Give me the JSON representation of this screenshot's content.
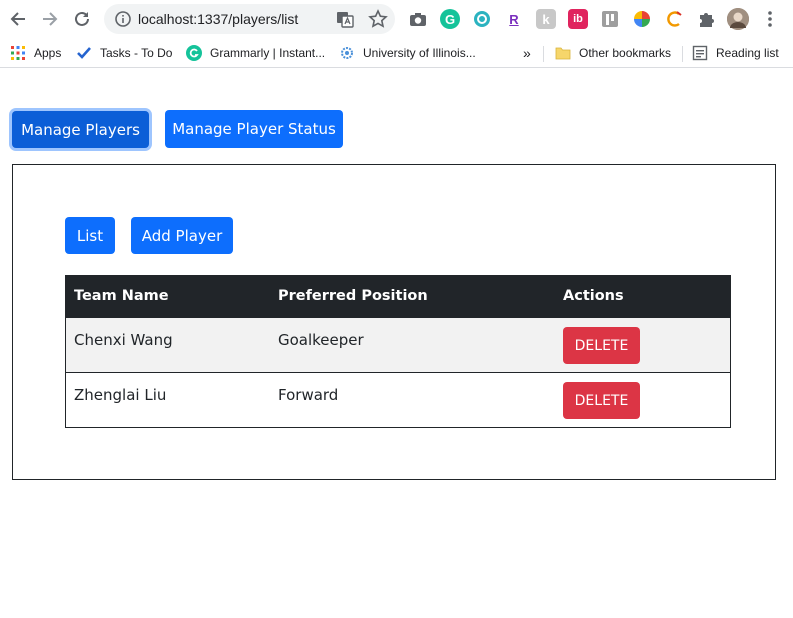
{
  "browser": {
    "url": "localhost:1337/players/list",
    "bookmarks": {
      "apps": "Apps",
      "tasks": "Tasks - To Do",
      "grammarly": "Grammarly | Instant...",
      "illinois": "University of Illinois...",
      "more": "»",
      "other": "Other bookmarks",
      "reading": "Reading list"
    },
    "extensions": {
      "grammarly_letter": "G",
      "r_letter": "R",
      "k_letter": "k",
      "ib_letter": "ib"
    }
  },
  "nav": {
    "manage_players": "Manage Players",
    "manage_status": "Manage Player Status"
  },
  "subnav": {
    "list": "List",
    "add_player": "Add Player"
  },
  "table": {
    "headers": {
      "name": "Team Name",
      "position": "Preferred Position",
      "actions": "Actions"
    },
    "rows": [
      {
        "name": "Chenxi Wang",
        "position": "Goalkeeper",
        "action": "DELETE"
      },
      {
        "name": "Zhenglai Liu",
        "position": "Forward",
        "action": "DELETE"
      }
    ]
  },
  "colors": {
    "primary": "#0d6efd",
    "danger": "#dc3545",
    "table_header": "#212529"
  }
}
